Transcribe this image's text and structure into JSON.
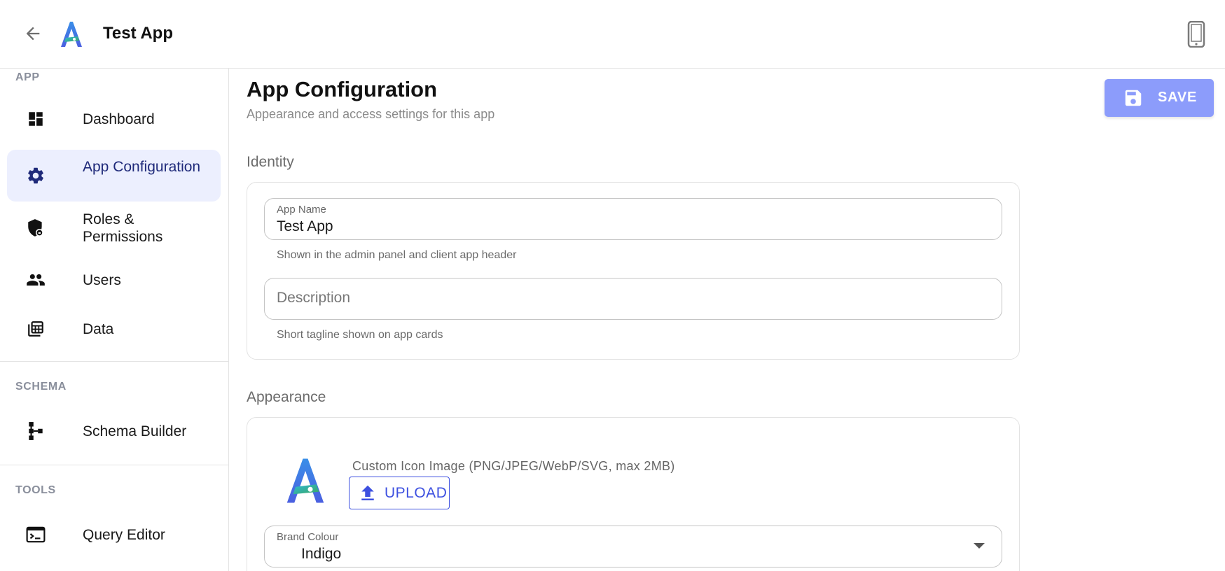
{
  "header": {
    "title": "Test App",
    "back_icon": "arrow-left-icon",
    "logo_icon": "app-logo-a-icon",
    "device_icon": "smartphone-icon"
  },
  "sidebar": {
    "sections": [
      {
        "label": "APP"
      },
      {
        "label": "SCHEMA"
      },
      {
        "label": "TOOLS"
      }
    ],
    "items": [
      {
        "label": "Dashboard",
        "icon": "dashboard-icon"
      },
      {
        "label": "App Configuration",
        "icon": "gear-icon",
        "active": true
      },
      {
        "label": "Roles & Permissions",
        "icon": "shield-lock-icon"
      },
      {
        "label": "Users",
        "icon": "people-icon"
      },
      {
        "label": "Data",
        "icon": "table-data-icon"
      },
      {
        "label": "Schema Builder",
        "icon": "schema-tree-icon"
      },
      {
        "label": "Query Editor",
        "icon": "terminal-icon"
      }
    ]
  },
  "main": {
    "title": "App Configuration",
    "subtitle": "Appearance and access settings for this app",
    "save_label": "SAVE",
    "save_icon": "floppy-disk-icon",
    "identity": {
      "section_title": "Identity",
      "app_name": {
        "label": "App Name",
        "value": "Test App",
        "helper": "Shown in the admin panel and client app header"
      },
      "description": {
        "placeholder": "Description",
        "value": "",
        "helper": "Short tagline shown on app cards"
      }
    },
    "appearance": {
      "section_title": "Appearance",
      "icon_label": "Custom Icon Image (PNG/JPEG/WebP/SVG, max 2MB)",
      "upload_label": "UPLOAD",
      "upload_icon": "upload-arrow-icon",
      "brand_colour": {
        "label": "Brand Colour",
        "value": "Indigo"
      }
    }
  },
  "colors": {
    "accent": "#3d50e0",
    "save_button": "#8c9cfb",
    "active_nav_bg": "#eceffe",
    "section_label": "#8a8f9c"
  }
}
